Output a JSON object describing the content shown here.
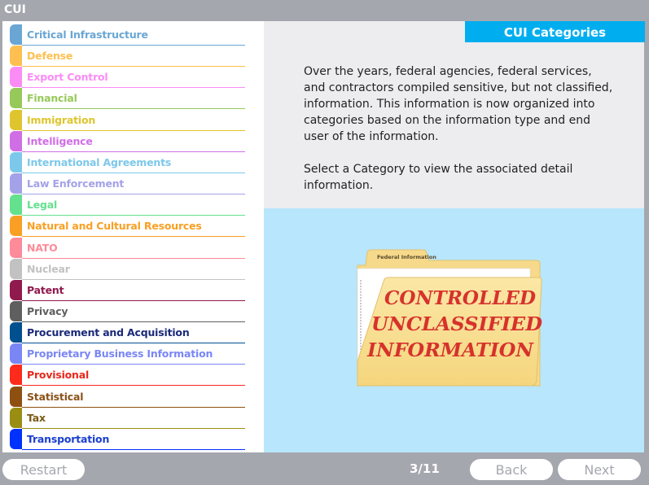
{
  "window": {
    "title": "CUI"
  },
  "categories": [
    {
      "label": "Critical Infrastructure",
      "color": "#6aa6d4"
    },
    {
      "label": "Defense",
      "color": "#fdc050"
    },
    {
      "label": "Export Control",
      "color": "#fb8cf5"
    },
    {
      "label": "Financial",
      "color": "#96c95a"
    },
    {
      "label": "Immigration",
      "color": "#dfc52d"
    },
    {
      "label": "Intelligence",
      "color": "#d06ee5"
    },
    {
      "label": "International Agreements",
      "color": "#7cc8ea"
    },
    {
      "label": "Law Enforcement",
      "color": "#a3a2e8"
    },
    {
      "label": "Legal",
      "color": "#64e18e"
    },
    {
      "label": "Natural and Cultural Resources",
      "color": "#f9a024"
    },
    {
      "label": "NATO",
      "color": "#fd8b99"
    },
    {
      "label": "Nuclear",
      "color": "#c2c2c2"
    },
    {
      "label": "Patent",
      "color": "#901a4e"
    },
    {
      "label": "Privacy",
      "color": "#5f5f5f"
    },
    {
      "label": "Procurement and Acquisition",
      "color": "#004f8f",
      "text_color": "#1b2a7a"
    },
    {
      "label": "Proprietary Business Information",
      "color": "#7a86f6"
    },
    {
      "label": "Provisional",
      "color": "#fe2a1c",
      "text_color": "#e8281b"
    },
    {
      "label": "Statistical",
      "color": "#8e5011",
      "text_color": "#8a5319"
    },
    {
      "label": "Tax",
      "color": "#998e12",
      "text_color": "#7a5a14"
    },
    {
      "label": "Transportation",
      "color": "#0031fd",
      "text_color": "#1a3fd0"
    }
  ],
  "content": {
    "header": "CUI Categories",
    "paragraphs": [
      "Over the years, federal agencies, federal services, and contractors compiled sensitive, but not classified, information. This information is now organized into categories based on the information type and end user of the information.",
      "Select a Category to view the associated detail information."
    ],
    "image": {
      "tab_label": "Federal Information",
      "stamp_lines": [
        "CONTROLLED",
        "UNCLASSIFIED",
        "INFORMATION"
      ]
    }
  },
  "footer": {
    "restart_label": "Restart",
    "page_counter": "3/11",
    "back_label": "Back",
    "next_label": "Next"
  }
}
